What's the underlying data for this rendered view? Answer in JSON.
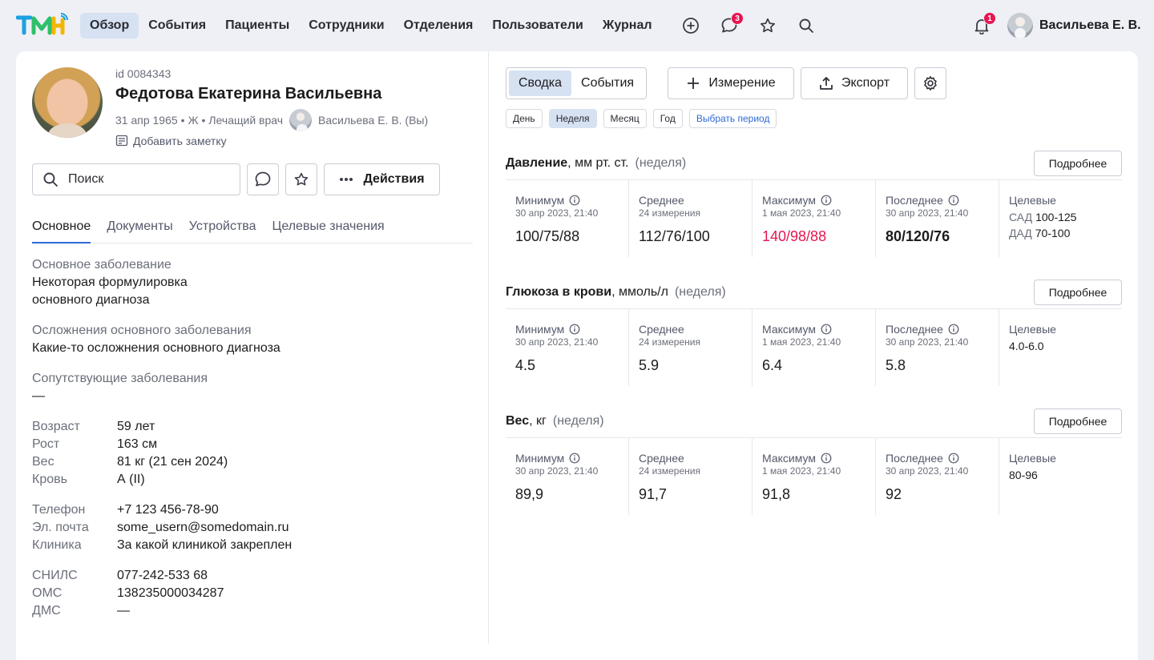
{
  "nav": {
    "items": [
      "Обзор",
      "События",
      "Пациенты",
      "Сотрудники",
      "Отделения",
      "Пользователи",
      "Журнал"
    ],
    "chat_badge": "3",
    "bell_badge": "1",
    "user_name": "Васильева Е. В."
  },
  "patient": {
    "id": "id 0084343",
    "name": "Федотова Екатерина Васильевна",
    "birth": "31 апр 1965",
    "sex": "Ж",
    "role": "Лечащий врач",
    "doctor": "Васильева Е. В. (Вы)",
    "add_note": "Добавить заметку",
    "sep": "•"
  },
  "search": {
    "placeholder": "Поиск"
  },
  "actions_label": "Действия",
  "tabs": [
    "Основное",
    "Документы",
    "Устройства",
    "Целевые значения"
  ],
  "info": {
    "main_disease_label": "Основное заболевание",
    "main_disease_l1": "Некоторая формулировка",
    "main_disease_l2": "основного диагноза",
    "complications_label": "Осложнения основного заболевания",
    "complications": "Какие-то осложнения основного диагноза",
    "concomitant_label": "Сопутствующие заболевания",
    "concomitant": "—",
    "group1": [
      {
        "k": "Возраст",
        "v": "59 лет"
      },
      {
        "k": "Рост",
        "v": "163 см"
      },
      {
        "k": "Вес",
        "v": "81 кг (21 сен 2024)"
      },
      {
        "k": "Кровь",
        "v": "А (II)"
      }
    ],
    "group2": [
      {
        "k": "Телефон",
        "v": "+7 123 456-78-90"
      },
      {
        "k": "Эл. почта",
        "v": "some_usern@somedomain.ru"
      },
      {
        "k": "Клиника",
        "v": "За какой клиникой закреплен"
      }
    ],
    "group3": [
      {
        "k": "СНИЛС",
        "v": "077-242-533 68"
      },
      {
        "k": "ОМС",
        "v": "138235000034287"
      },
      {
        "k": "ДМС",
        "v": "—"
      }
    ]
  },
  "right": {
    "seg": [
      "Сводка",
      "События"
    ],
    "measure_label": "Измерение",
    "export_label": "Экспорт",
    "periods": [
      "День",
      "Неделя",
      "Месяц",
      "Год",
      "Выбрать период"
    ],
    "more_label": "Подробнее",
    "cell_labels": {
      "min": "Минимум",
      "avg": "Среднее",
      "max": "Максимум",
      "last": "Последнее",
      "target": "Целевые"
    }
  },
  "metrics": [
    {
      "title": "Давление",
      "unit": ", мм рт. ст.",
      "period": "(неделя)",
      "min_date": "30 апр 2023, 21:40",
      "min": "100/75/88",
      "avg_count": "24 измерения",
      "avg": "112/76/100",
      "max_date": "1 мая 2023, 21:40",
      "max": "140/98/88",
      "last_date": "30 апр 2023, 21:40",
      "last": "80/120/76",
      "targets": [
        {
          "k": "САД",
          "v": "100-125"
        },
        {
          "k": "ДАД",
          "v": "70-100"
        }
      ]
    },
    {
      "title": "Глюкоза в крови",
      "unit": ", ммоль/л",
      "period": "(неделя)",
      "min_date": "30 апр 2023, 21:40",
      "min": "4.5",
      "avg_count": "24 измерения",
      "avg": "5.9",
      "max_date": "1 мая 2023, 21:40",
      "max": "6.4",
      "last_date": "30 апр 2023, 21:40",
      "last": "5.8",
      "targets": [
        {
          "k": "",
          "v": "4.0-6.0"
        }
      ]
    },
    {
      "title": "Вес",
      "unit": ", кг",
      "period": "(неделя)",
      "min_date": "30 апр 2023, 21:40",
      "min": "89,9",
      "avg_count": "24 измерения",
      "avg": "91,7",
      "max_date": "1 мая 2023, 21:40",
      "max": "91,8",
      "last_date": "30 апр 2023, 21:40",
      "last": "92",
      "targets": [
        {
          "k": "",
          "v": "80-96"
        }
      ]
    }
  ],
  "colors": {
    "accent": "#2e6ad6",
    "active_bg": "#d6e1f2",
    "alert": "#e8154f"
  }
}
